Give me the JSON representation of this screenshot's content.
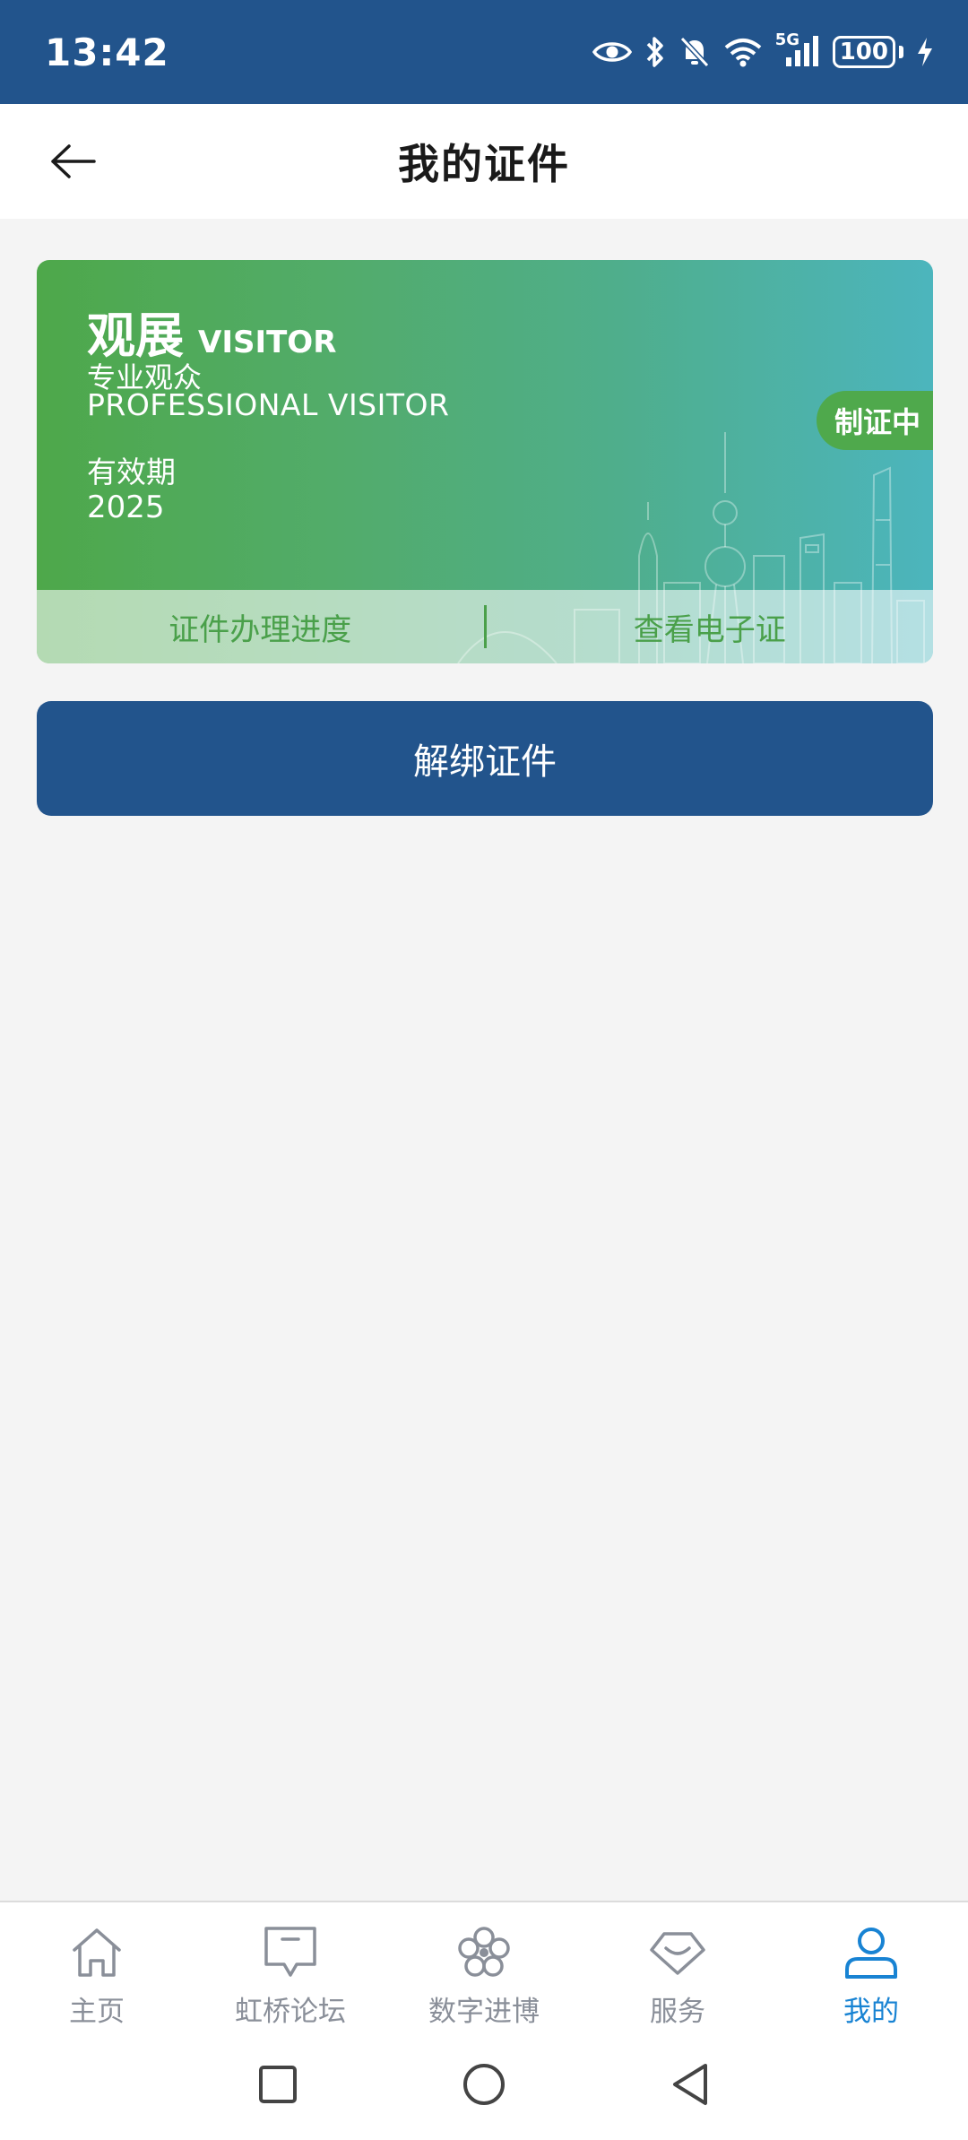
{
  "status_bar": {
    "time": "13:42",
    "network": "5G",
    "battery": "100",
    "icons": [
      "eye-icon",
      "bluetooth-icon",
      "bell-off-icon",
      "wifi-icon",
      "signal-icon",
      "battery-icon",
      "charging-icon"
    ]
  },
  "header": {
    "title": "我的证件",
    "back_icon": "arrow-left-icon"
  },
  "card": {
    "type_cn": "观展",
    "type_en": "VISITOR",
    "category_cn": "专业观众",
    "category_en": "PROFESSIONAL VISITOR",
    "validity_label": "有效期",
    "validity_year": "2025",
    "status": "制证中",
    "actions": {
      "progress": "证件办理进度",
      "view_ecert": "查看电子证"
    },
    "colors": {
      "gradient_start": "#4ea84a",
      "gradient_end": "#4cb5bd",
      "badge": "#4fa94c",
      "action_text": "#4aa04a"
    }
  },
  "unbind_button": {
    "label": "解绑证件",
    "color": "#22548c"
  },
  "tabs": [
    {
      "label": "主页",
      "icon": "home-icon",
      "active": false
    },
    {
      "label": "虹桥论坛",
      "icon": "forum-icon",
      "active": false
    },
    {
      "label": "数字进博",
      "icon": "flower-icon",
      "active": false
    },
    {
      "label": "服务",
      "icon": "service-icon",
      "active": false
    },
    {
      "label": "我的",
      "icon": "profile-icon",
      "active": true
    }
  ],
  "system_nav": {
    "icons": [
      "recent-apps-icon",
      "home-circle-icon",
      "back-triangle-icon"
    ]
  },
  "theme": {
    "primary": "#22548c",
    "active_tab": "#1883d3",
    "inactive_tab": "#8a8f99",
    "background": "#f4f4f4"
  }
}
